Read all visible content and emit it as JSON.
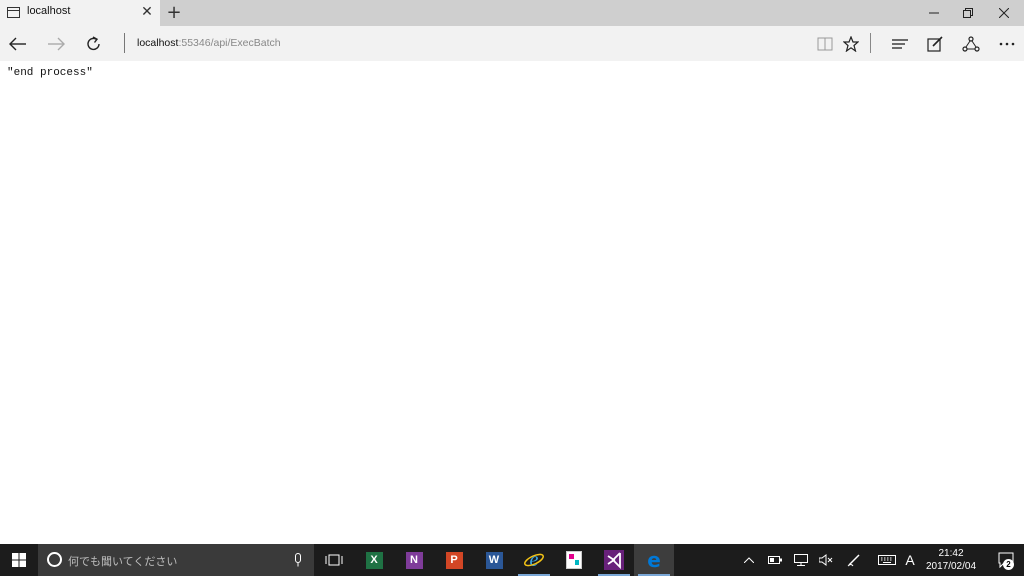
{
  "tab": {
    "title": "localhost"
  },
  "address": {
    "host": "localhost",
    "rest": ":55346/api/ExecBatch"
  },
  "page": {
    "response_text": "\"end process\""
  },
  "taskbar": {
    "search_placeholder": "何でも聞いてください",
    "apps": [
      {
        "name": "Excel",
        "letter": "X",
        "color": "#1f7244"
      },
      {
        "name": "OneNote",
        "letter": "N",
        "color": "#7f3c9a"
      },
      {
        "name": "PowerPoint",
        "letter": "P",
        "color": "#d24625"
      },
      {
        "name": "Word",
        "letter": "W",
        "color": "#2b5797"
      }
    ],
    "ime_label": "A",
    "clock": {
      "time": "21:42",
      "date": "2017/02/04"
    },
    "notifications_count": "2"
  },
  "colors": {
    "edge_blue": "#0078d7",
    "vs_purple": "#68217a",
    "accent_underline": "#7aa7d6"
  }
}
